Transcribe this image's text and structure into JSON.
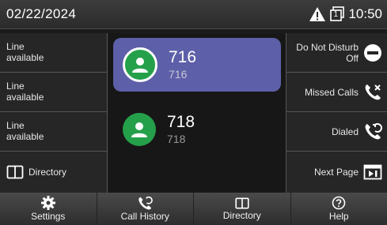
{
  "status_bar": {
    "date": "02/22/2024",
    "time": "10:50",
    "line_number_icon": "1"
  },
  "left_keys": [
    {
      "label_line1": "Line",
      "label_line2": "available"
    },
    {
      "label_line1": "Line",
      "label_line2": "available"
    },
    {
      "label_line1": "Line",
      "label_line2": "available"
    },
    {
      "label": "Directory",
      "icon": "book-icon"
    }
  ],
  "lines": [
    {
      "primary": "716",
      "secondary": "716",
      "selected": true
    },
    {
      "primary": "718",
      "secondary": "718",
      "selected": false
    }
  ],
  "right_keys": [
    {
      "label_line1": "Do Not Disturb",
      "label_line2": "Off",
      "icon": "dnd-icon"
    },
    {
      "label": "Missed Calls",
      "icon": "missed-call-icon"
    },
    {
      "label": "Dialed",
      "icon": "dialed-call-icon"
    },
    {
      "label": "Next Page",
      "icon": "next-page-icon"
    }
  ],
  "bottom_nav": [
    {
      "label": "Settings",
      "icon": "gear-icon"
    },
    {
      "label": "Call History",
      "icon": "call-history-icon"
    },
    {
      "label": "Directory",
      "icon": "book-icon"
    },
    {
      "label": "Help",
      "icon": "help-icon"
    }
  ],
  "colors": {
    "selected_card": "#5d5fa8",
    "avatar": "#25a04a",
    "warning": "#ffffff"
  }
}
